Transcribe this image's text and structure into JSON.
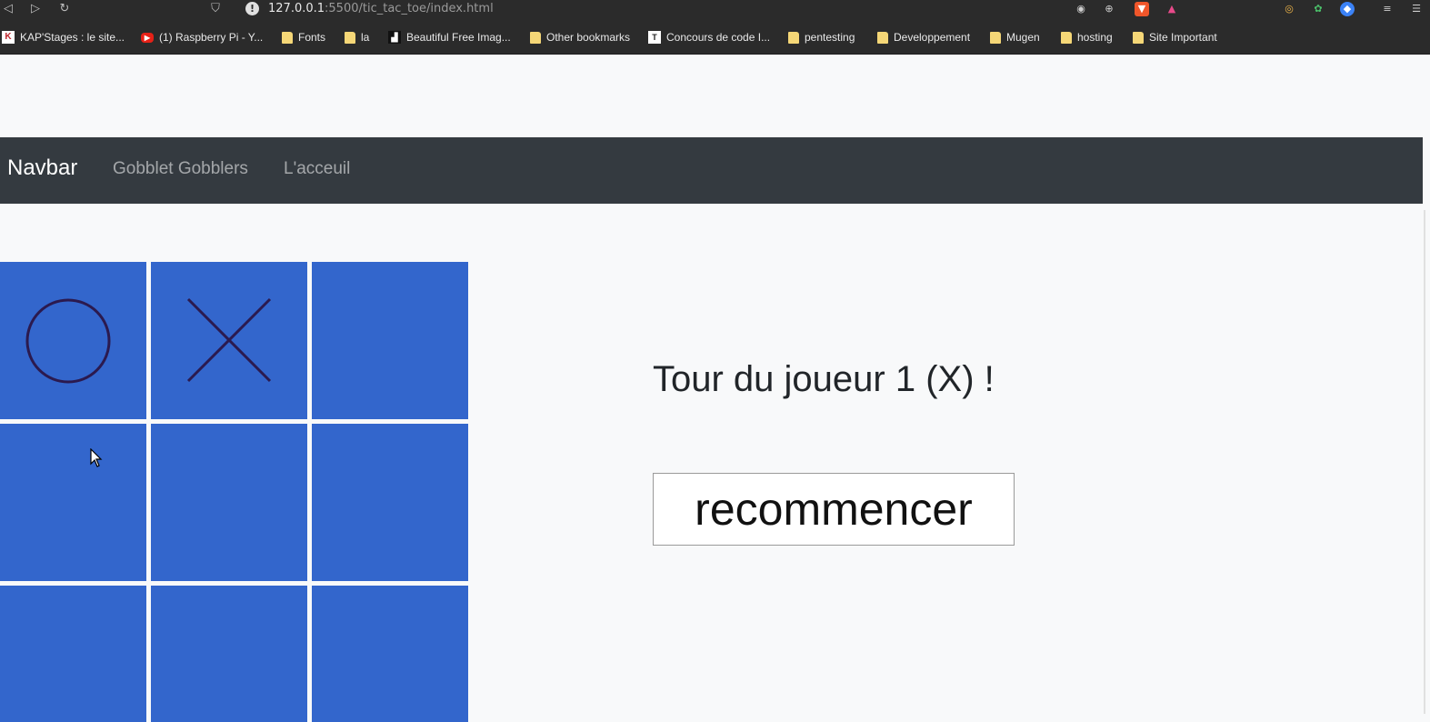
{
  "browser": {
    "url_host": "127.0.0.1",
    "url_rest": ":5500/tic_tac_toe/index.html",
    "bookmarks": [
      {
        "label": "KAP'Stages : le site...",
        "icon": "kapstages-favicon"
      },
      {
        "label": "(1) Raspberry Pi - Y...",
        "icon": "youtube-favicon"
      },
      {
        "label": "Fonts",
        "icon": "folder-icon"
      },
      {
        "label": "la",
        "icon": "folder-icon"
      },
      {
        "label": "Beautiful Free Imag...",
        "icon": "unsplash-favicon"
      },
      {
        "label": "Other bookmarks",
        "icon": "folder-icon"
      },
      {
        "label": "Concours de code I...",
        "icon": "site-favicon"
      },
      {
        "label": "pentesting",
        "icon": "folder-icon"
      },
      {
        "label": "Developpement",
        "icon": "folder-icon"
      },
      {
        "label": "Mugen",
        "icon": "folder-icon"
      },
      {
        "label": "hosting",
        "icon": "folder-icon"
      },
      {
        "label": "Site Important",
        "icon": "folder-icon"
      }
    ]
  },
  "navbar": {
    "brand": "Navbar",
    "links": [
      "Gobblet Gobblers",
      "L'acceuil"
    ]
  },
  "game": {
    "board": [
      "O",
      "X",
      "",
      "",
      "",
      "",
      "",
      "",
      ""
    ],
    "turn_text": "Tour du joueur 1 (X) !",
    "restart_label": "recommencer"
  },
  "colors": {
    "cell": "#3366cc",
    "mark": "#2b1a4f",
    "navbar": "#343a40"
  }
}
